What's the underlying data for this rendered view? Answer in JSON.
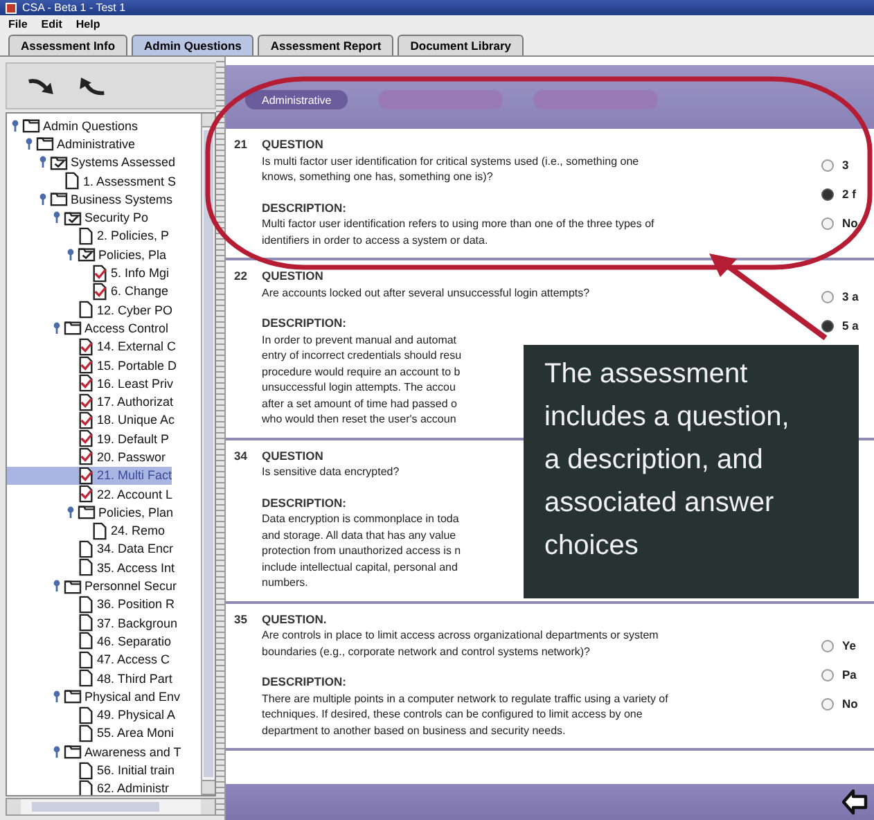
{
  "window": {
    "title": "CSA - Beta 1 - Test 1"
  },
  "menu": [
    "File",
    "Edit",
    "Help"
  ],
  "tabs": [
    {
      "label": "Assessment Info",
      "selected": false
    },
    {
      "label": "Admin Questions",
      "selected": true
    },
    {
      "label": "Assessment Report",
      "selected": false
    },
    {
      "label": "Document Library",
      "selected": false
    }
  ],
  "tree": [
    {
      "kind": "folder",
      "label": "Admin Questions",
      "checked": false,
      "expanded": true,
      "selected": false,
      "children": [
        {
          "kind": "folder",
          "label": "Administrative",
          "checked": false,
          "expanded": true,
          "selected": false,
          "children": [
            {
              "kind": "folder",
              "label": "Systems Assessed",
              "checked": true,
              "expanded": true,
              "selected": false,
              "children": [
                {
                  "kind": "question",
                  "label": "1. Assessment S",
                  "answered": false,
                  "selected": false
                }
              ]
            },
            {
              "kind": "folder",
              "label": "Business Systems",
              "checked": false,
              "expanded": true,
              "selected": false,
              "children": [
                {
                  "kind": "folder",
                  "label": "Security Po",
                  "checked": true,
                  "expanded": true,
                  "selected": false,
                  "children": [
                    {
                      "kind": "question",
                      "label": "2. Policies, P",
                      "answered": false,
                      "selected": false
                    },
                    {
                      "kind": "folder",
                      "label": "Policies, Pla",
                      "checked": true,
                      "expanded": true,
                      "selected": false,
                      "children": [
                        {
                          "kind": "question",
                          "label": "5. Info Mgi",
                          "answered": true,
                          "selected": false
                        },
                        {
                          "kind": "question",
                          "label": "6. Change",
                          "answered": true,
                          "selected": false
                        }
                      ]
                    },
                    {
                      "kind": "question",
                      "label": "12. Cyber PO",
                      "answered": false,
                      "selected": false
                    }
                  ]
                },
                {
                  "kind": "folder",
                  "label": "Access Control",
                  "checked": false,
                  "expanded": true,
                  "selected": false,
                  "children": [
                    {
                      "kind": "question",
                      "label": "14. External C",
                      "answered": true,
                      "selected": false
                    },
                    {
                      "kind": "question",
                      "label": "15. Portable D",
                      "answered": true,
                      "selected": false
                    },
                    {
                      "kind": "question",
                      "label": "16. Least Priv",
                      "answered": true,
                      "selected": false
                    },
                    {
                      "kind": "question",
                      "label": "17. Authorizat",
                      "answered": true,
                      "selected": false
                    },
                    {
                      "kind": "question",
                      "label": "18. Unique Ac",
                      "answered": true,
                      "selected": false
                    },
                    {
                      "kind": "question",
                      "label": "19. Default P",
                      "answered": true,
                      "selected": false
                    },
                    {
                      "kind": "question",
                      "label": "20. Passwor",
                      "answered": true,
                      "selected": false
                    },
                    {
                      "kind": "question",
                      "label": "21. Multi Fact",
                      "answered": true,
                      "selected": true
                    },
                    {
                      "kind": "question",
                      "label": "22. Account L",
                      "answered": true,
                      "selected": false
                    },
                    {
                      "kind": "folder",
                      "label": "Policies, Plan",
                      "checked": false,
                      "expanded": true,
                      "selected": false,
                      "children": [
                        {
                          "kind": "question",
                          "label": "24. Remo",
                          "answered": false,
                          "selected": false
                        }
                      ]
                    },
                    {
                      "kind": "question",
                      "label": "34. Data Encr",
                      "answered": false,
                      "selected": false
                    },
                    {
                      "kind": "question",
                      "label": "35. Access Int",
                      "answered": false,
                      "selected": false
                    }
                  ]
                },
                {
                  "kind": "folder",
                  "label": "Personnel Secur",
                  "checked": false,
                  "expanded": true,
                  "selected": false,
                  "children": [
                    {
                      "kind": "question",
                      "label": "36. Position R",
                      "answered": false,
                      "selected": false
                    },
                    {
                      "kind": "question",
                      "label": "37. Backgroun",
                      "answered": false,
                      "selected": false
                    },
                    {
                      "kind": "question",
                      "label": "46. Separatio",
                      "answered": false,
                      "selected": false
                    },
                    {
                      "kind": "question",
                      "label": "47. Access C",
                      "answered": false,
                      "selected": false
                    },
                    {
                      "kind": "question",
                      "label": "48. Third Part",
                      "answered": false,
                      "selected": false
                    }
                  ]
                },
                {
                  "kind": "folder",
                  "label": "Physical and Env",
                  "checked": false,
                  "expanded": true,
                  "selected": false,
                  "children": [
                    {
                      "kind": "question",
                      "label": "49. Physical A",
                      "answered": false,
                      "selected": false
                    },
                    {
                      "kind": "question",
                      "label": "55. Area Moni",
                      "answered": false,
                      "selected": false
                    }
                  ]
                },
                {
                  "kind": "folder",
                  "label": "Awareness and T",
                  "checked": false,
                  "expanded": true,
                  "selected": false,
                  "children": [
                    {
                      "kind": "question",
                      "label": "56. Initial train",
                      "answered": false,
                      "selected": false
                    },
                    {
                      "kind": "question",
                      "label": "62. Administr",
                      "answered": false,
                      "selected": false
                    }
                  ]
                }
              ]
            }
          ]
        }
      ]
    }
  ],
  "subtabs": [
    {
      "label": "Administrative",
      "selected": true
    }
  ],
  "questions": [
    {
      "number": "21",
      "question_label": "QUESTION",
      "question_lines": [
        "Is multi factor user identification for critical systems used (i.e., something one",
        "knows, something one has, something one is)?"
      ],
      "description_label": "DESCRIPTION:",
      "description_lines": [
        "Multi factor user identification refers to using more than one of the three types of",
        "identifiers in order to access a system or data."
      ],
      "options": [
        {
          "label": "3",
          "selected": false
        },
        {
          "label": "2 f",
          "selected": true
        },
        {
          "label": "No",
          "selected": false
        }
      ]
    },
    {
      "number": "22",
      "question_label": "QUESTION",
      "question_lines": [
        "Are accounts locked out after several unsuccessful login attempts?"
      ],
      "description_label": "DESCRIPTION:",
      "description_lines": [
        "In order to prevent manual and automat",
        "entry of incorrect credentials should resu",
        "procedure would require an account to b",
        "unsuccessful login attempts. The accou",
        "after a set amount of time had passed o",
        "who would then reset the user's accoun"
      ],
      "options": [
        {
          "label": "3 a",
          "selected": false
        },
        {
          "label": "5 a",
          "selected": true
        }
      ]
    },
    {
      "number": "34",
      "question_label": "QUESTION",
      "question_lines": [
        "Is sensitive data encrypted?"
      ],
      "description_label": "DESCRIPTION:",
      "description_lines": [
        "Data encryption is commonplace in toda",
        "and storage.  All data that has any value",
        "protection from unauthorized access is n",
        "include intellectual capital, personal and",
        "numbers."
      ]
    },
    {
      "number": "35",
      "question_label": "QUESTION.",
      "question_lines": [
        "Are controls in place to limit access across organizational departments or system",
        "boundaries (e.g., corporate network and control systems network)?"
      ],
      "description_label": "DESCRIPTION:",
      "description_lines": [
        "There are multiple points in a computer network to regulate traffic using a variety of",
        "techniques.  If desired, these controls can be configured to limit access by one",
        "department to another based on business and security needs."
      ],
      "options": [
        {
          "label": "Ye",
          "selected": false
        },
        {
          "label": "Pa",
          "selected": false
        },
        {
          "label": "No",
          "selected": false
        }
      ]
    }
  ],
  "callout": {
    "text": "The assessment includes a question, a description, and associated answer choices"
  }
}
